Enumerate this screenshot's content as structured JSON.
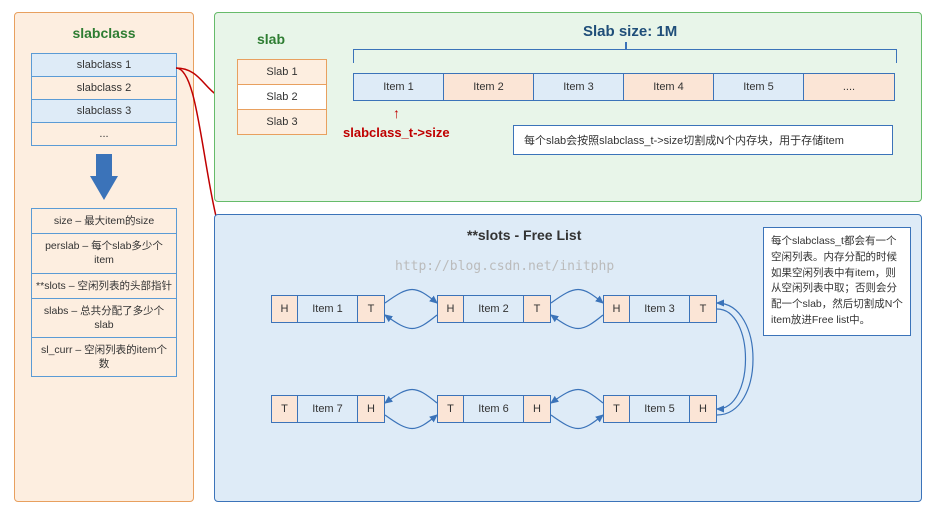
{
  "left": {
    "title": "slabclass",
    "classes": [
      "slabclass 1",
      "slabclass 2",
      "slabclass 3",
      "..."
    ],
    "fields": [
      "size – 最大item的size",
      "perslab – 每个slab多少个item",
      "**slots – 空闲列表的头部指针",
      "slabs – 总共分配了多少个slab",
      "sl_curr – 空闲列表的item个数"
    ]
  },
  "top": {
    "slab_title": "slab",
    "slabs": [
      "Slab 1",
      "Slab 2",
      "Slab 3"
    ],
    "size_title": "Slab size: 1M",
    "items": [
      "Item 1",
      "Item 2",
      "Item 3",
      "Item 4",
      "Item 5",
      "...."
    ],
    "red_label": "slabclass_t->size",
    "note": "每个slab会按照slabclass_t->size切割成N个内存块，用于存储item"
  },
  "bot": {
    "title": "**slots - Free List",
    "watermark": "http://blog.csdn.net/initphp",
    "desc": "每个slabclass_t都会有一个空闲列表。内存分配的时候如果空闲列表中有item，则从空闲列表中取；否则会分配一个slab，然后切割成N个item放进Free list中。",
    "H": "H",
    "T": "T",
    "nodes_top": [
      "Item 1",
      "Item 2",
      "Item 3"
    ],
    "nodes_bot": [
      "Item 7",
      "Item 6",
      "Item 5"
    ]
  }
}
